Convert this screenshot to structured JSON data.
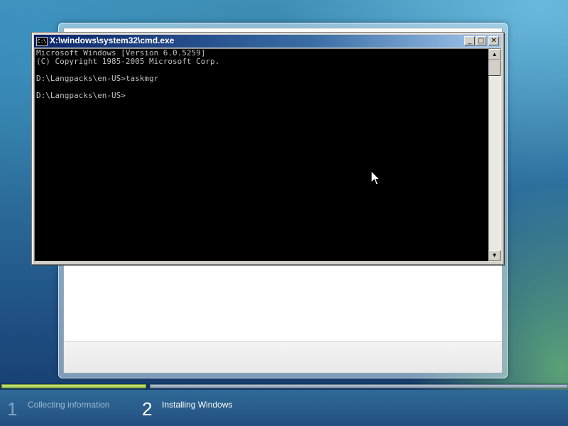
{
  "cmd_window": {
    "title": "X:\\windows\\system32\\cmd.exe",
    "icon_text": "C:\\",
    "console_lines": [
      "Microsoft Windows [Version 6.0.5259]",
      "(C) Copyright 1985-2005 Microsoft Corp.",
      "",
      "D:\\Langpacks\\en-US>taskmgr",
      "",
      "D:\\Langpacks\\en-US>"
    ],
    "controls": {
      "minimize": "_",
      "maximize": "□",
      "close": "✕"
    }
  },
  "setup_progress": {
    "steps": [
      {
        "number": "1",
        "label": "Collecting information",
        "state": "complete"
      },
      {
        "number": "2",
        "label": "Installing Windows",
        "state": "current"
      }
    ]
  },
  "colors": {
    "console_background": "#000000",
    "console_text": "#c0c0c0",
    "title_bar": "#0a246a",
    "progress_complete": "#9bc24a"
  }
}
